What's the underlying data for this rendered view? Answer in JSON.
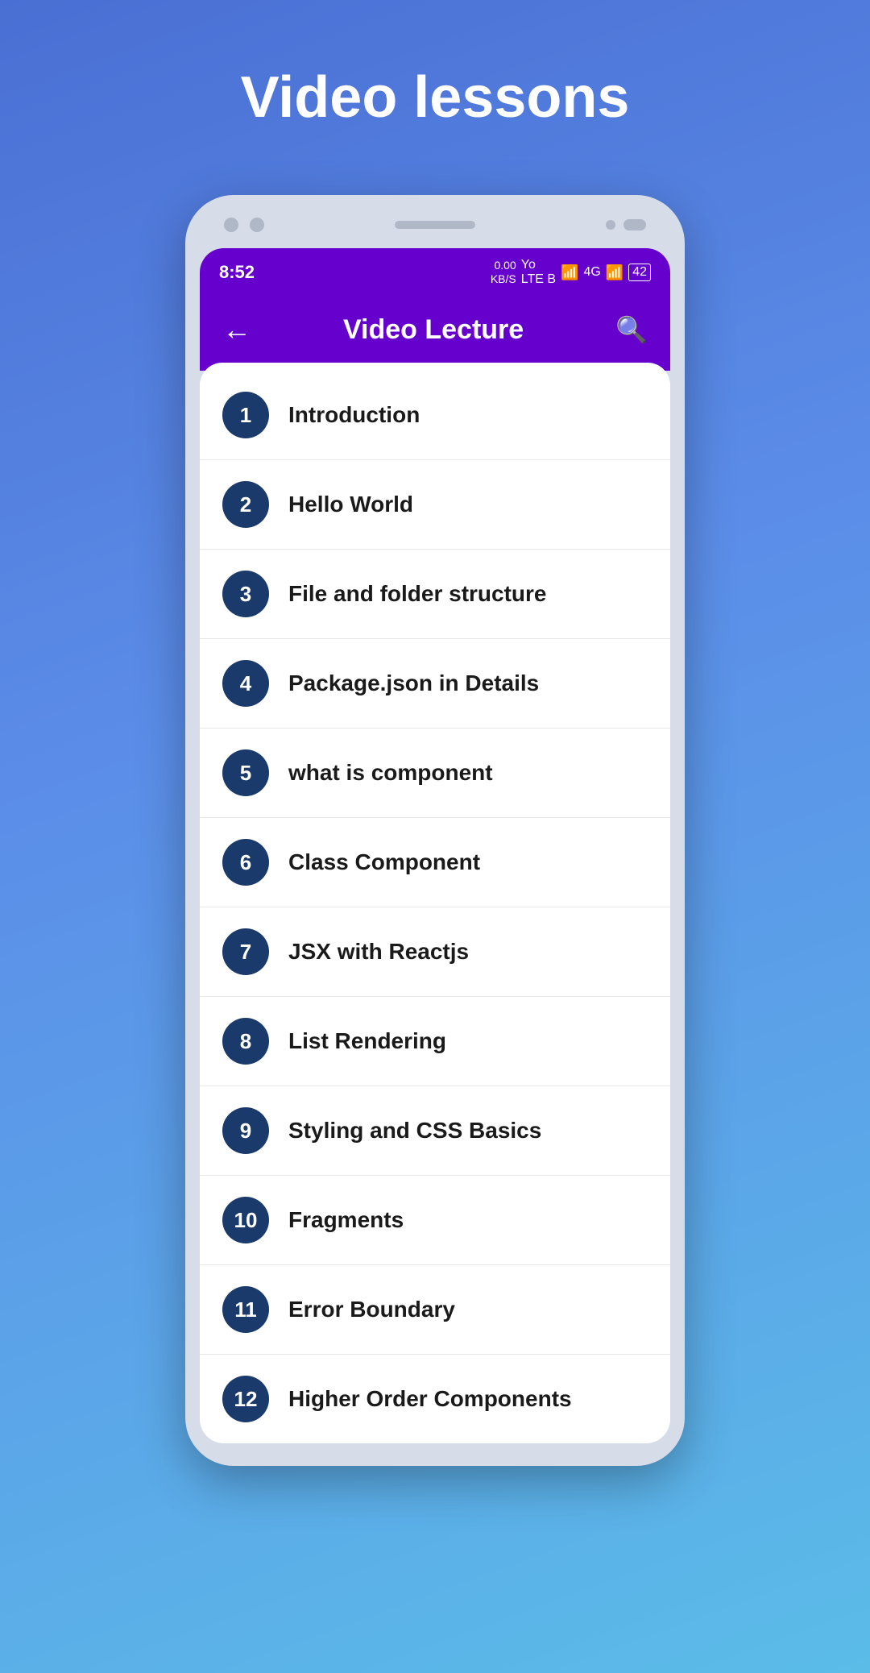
{
  "page": {
    "title": "Video lessons"
  },
  "status_bar": {
    "time": "8:52",
    "data_speed_top": "0.00",
    "data_speed_unit": "KB/S",
    "carrier": "Yo",
    "carrier_label": "LTE B",
    "network": "4G",
    "battery": "42"
  },
  "app_bar": {
    "title": "Video Lecture",
    "back_label": "←",
    "search_label": "⌕"
  },
  "lessons": [
    {
      "number": "1",
      "title": "Introduction"
    },
    {
      "number": "2",
      "title": "Hello World"
    },
    {
      "number": "3",
      "title": "File and folder structure"
    },
    {
      "number": "4",
      "title": "Package.json in Details"
    },
    {
      "number": "5",
      "title": "what is component"
    },
    {
      "number": "6",
      "title": "Class Component"
    },
    {
      "number": "7",
      "title": "JSX with Reactjs"
    },
    {
      "number": "8",
      "title": "List Rendering"
    },
    {
      "number": "9",
      "title": "Styling and CSS Basics"
    },
    {
      "number": "10",
      "title": "Fragments"
    },
    {
      "number": "11",
      "title": "Error Boundary"
    },
    {
      "number": "12",
      "title": "Higher Order Components"
    }
  ]
}
